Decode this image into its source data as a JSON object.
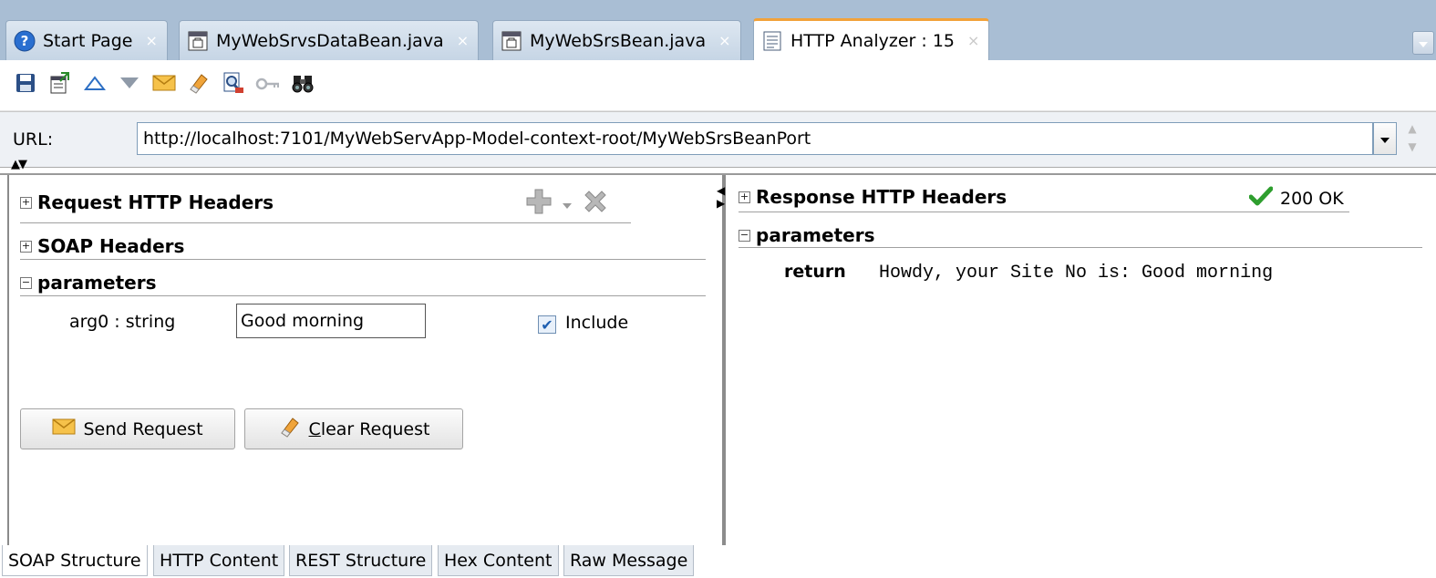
{
  "tabs": [
    {
      "label": "Start Page",
      "icon": "help-icon",
      "active": false
    },
    {
      "label": "MyWebSrvsDataBean.java",
      "icon": "java-file-icon",
      "active": false
    },
    {
      "label": "MyWebSrsBean.java",
      "icon": "java-file-icon",
      "active": false
    },
    {
      "label": "HTTP Analyzer : 15",
      "icon": "document-icon",
      "active": true
    }
  ],
  "tab_close_glyph": "×",
  "toolbar": {
    "icons": [
      "save-icon",
      "export-icon",
      "up-icon",
      "down-icon",
      "mail-icon",
      "eraser-icon",
      "preview-icon",
      "key-icon",
      "binoculars-icon"
    ]
  },
  "url": {
    "label": "URL:",
    "value": "http://localhost:7101/MyWebServApp-Model-context-root/MyWebSrsBeanPort"
  },
  "request": {
    "http_headers_label": "Request HTTP Headers",
    "soap_headers_label": "SOAP Headers",
    "parameters_label": "parameters",
    "param_name": "arg0 : string",
    "param_value": "Good morning",
    "include_label": "Include",
    "include_checked": true,
    "send_button": "Send Request",
    "clear_button_mnemonic": "C",
    "clear_button_rest": "lear Request"
  },
  "response": {
    "http_headers_label": "Response HTTP Headers",
    "status": "200 OK",
    "parameters_label": "parameters",
    "return_label": "return",
    "return_value": "Howdy, your Site No is: Good morning"
  },
  "bottom_tabs": [
    "SOAP Structure",
    "HTTP Content",
    "REST Structure",
    "Hex Content",
    "Raw Message"
  ],
  "colors": {
    "tab_strip": "#a9bed4",
    "active_tab_accent": "#f2a23a",
    "status_ok": "#2e9e2e"
  }
}
